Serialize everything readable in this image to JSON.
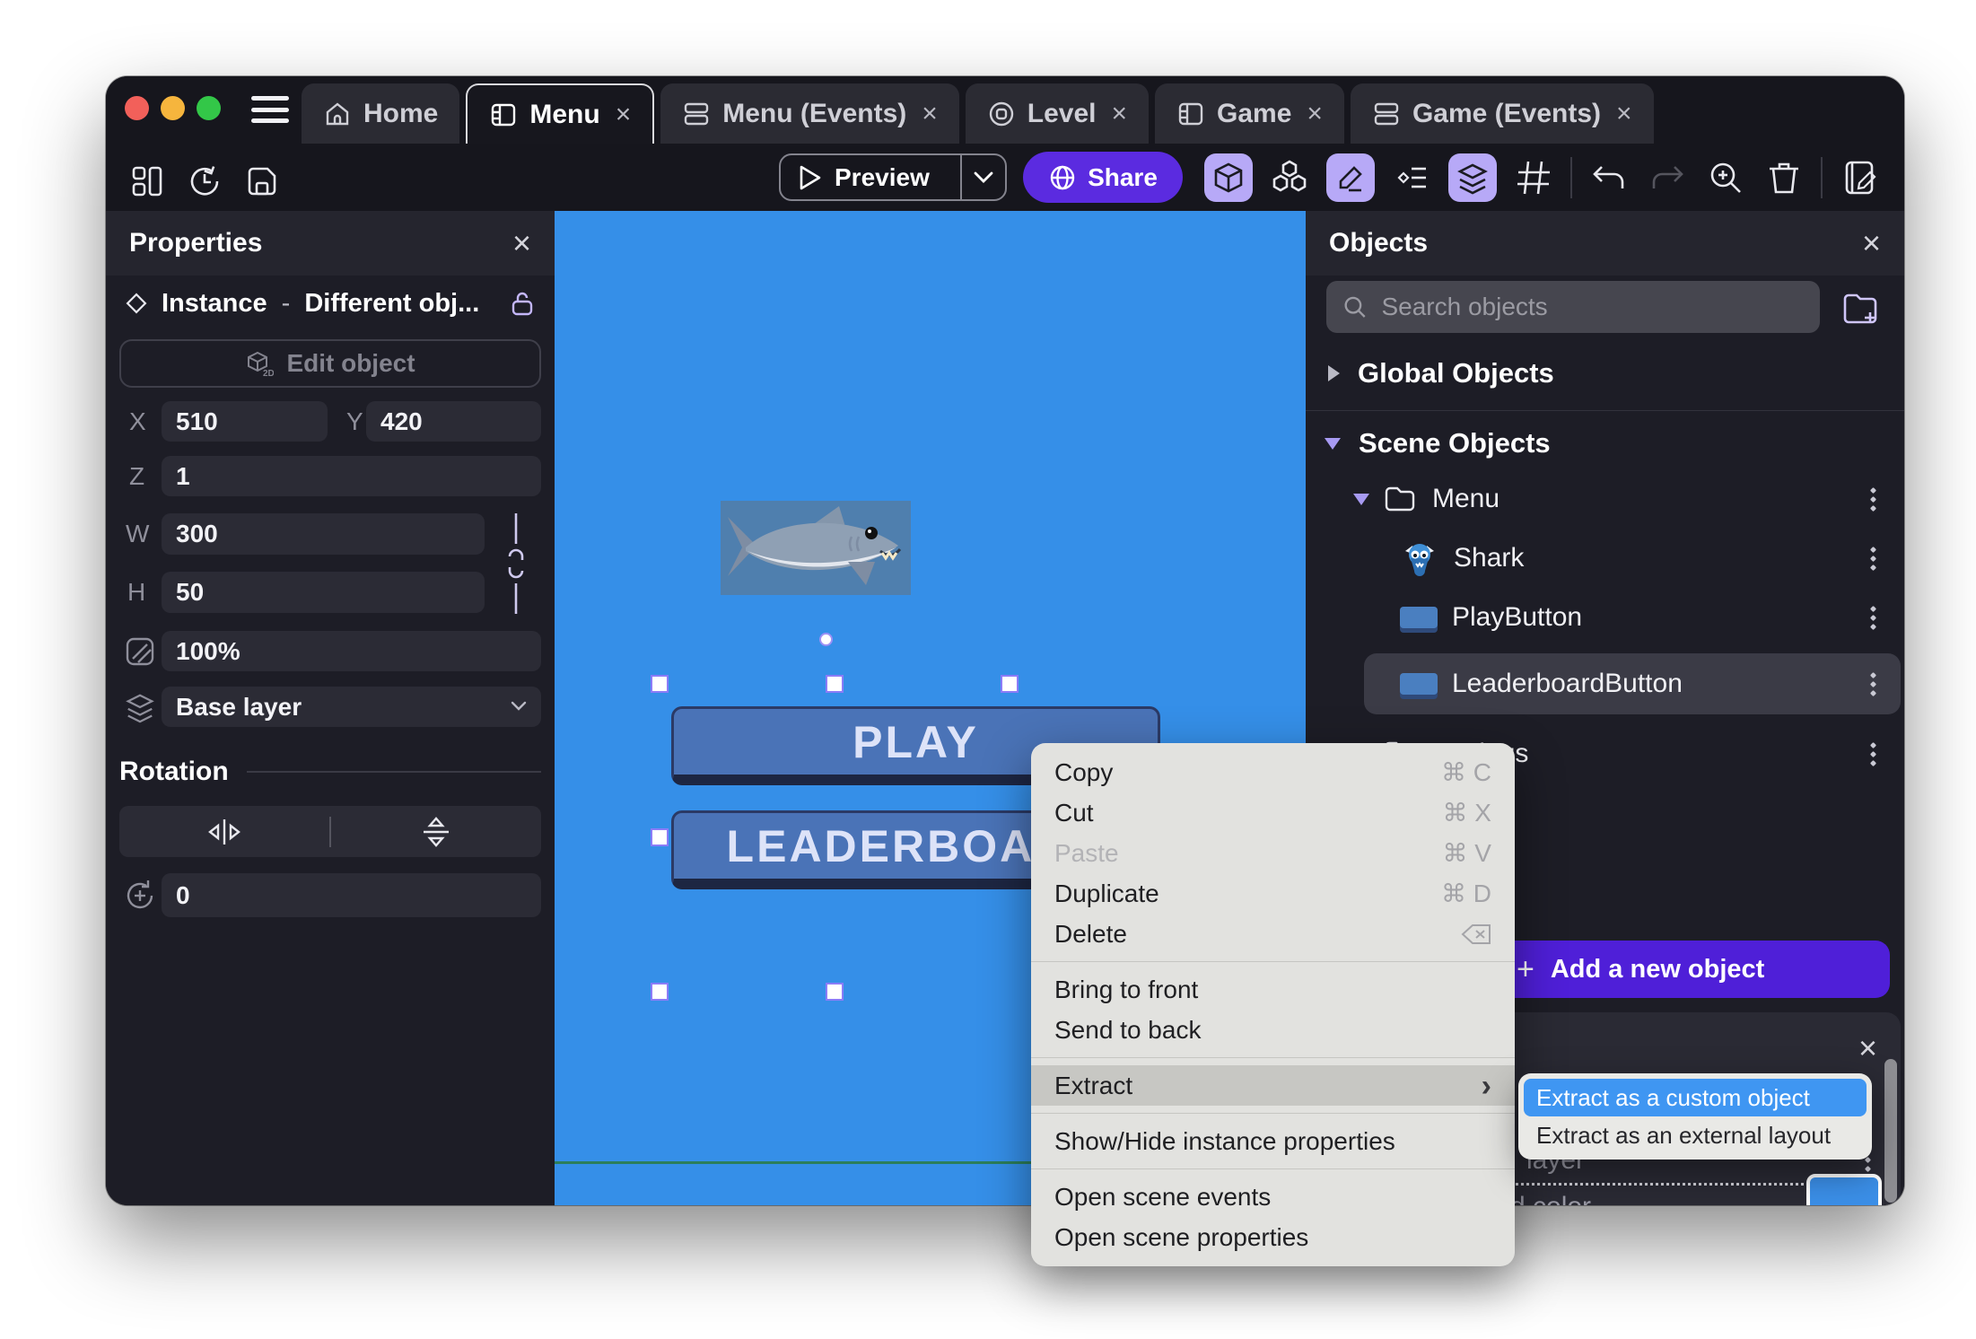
{
  "ui": {
    "close": "×",
    "submenu_arrow": "›",
    "plus": "+"
  },
  "titlebar": {
    "tabs": [
      {
        "label": "Home"
      },
      {
        "label": "Menu"
      },
      {
        "label": "Menu (Events)"
      },
      {
        "label": "Level"
      },
      {
        "label": "Game"
      },
      {
        "label": "Game (Events)"
      }
    ]
  },
  "toolbar": {
    "preview": "Preview",
    "share": "Share"
  },
  "properties": {
    "title": "Properties",
    "instance": "Instance",
    "separator": "-",
    "instance_value": "Different obj...",
    "edit_object": "Edit object",
    "edit_object_badge": "2D",
    "x_label": "X",
    "x_value": "510",
    "y_label": "Y",
    "y_value": "420",
    "z_label": "Z",
    "z_value": "1",
    "w_label": "W",
    "w_value": "300",
    "h_label": "H",
    "h_value": "50",
    "opacity_value": "100%",
    "layer_value": "Base layer",
    "rotation_title": "Rotation",
    "rotation_value": "0"
  },
  "canvas": {
    "play": "PLAY",
    "leaderboard": "LEADERBOARD"
  },
  "objects": {
    "title": "Objects",
    "search_placeholder": "Search objects",
    "global_header": "Global Objects",
    "scene_header": "Scene Objects",
    "folder_menu": "Menu",
    "item_shark": "Shark",
    "item_play": "PlayButton",
    "item_leaderboard": "LeaderboardButton",
    "folder_settings": "Settings",
    "add_button": "Add a new object",
    "layer_fragment": "layer",
    "color_fragment": "d color"
  },
  "context_menu": {
    "items": [
      {
        "label": "Copy",
        "shortcut": "⌘ C"
      },
      {
        "label": "Cut",
        "shortcut": "⌘ X"
      },
      {
        "label": "Paste",
        "shortcut": "⌘ V"
      },
      {
        "label": "Duplicate",
        "shortcut": "⌘ D"
      },
      {
        "label": "Delete"
      },
      {
        "label": "Bring to front"
      },
      {
        "label": "Send to back"
      },
      {
        "label": "Extract"
      },
      {
        "label": "Show/Hide instance properties"
      },
      {
        "label": "Open scene events"
      },
      {
        "label": "Open scene properties"
      }
    ]
  },
  "submenu": {
    "items": [
      {
        "label": "Extract as a custom object"
      },
      {
        "label": "Extract as an external layout"
      }
    ]
  },
  "colors": {
    "canvas_blue": "#358fe8",
    "share_purple": "#5b2be0",
    "add_button_purple": "#4f1fd8",
    "selection_purple": "#8b7cf7",
    "scene_button_blue": "#4a73b7",
    "submenu_highlight_blue": "#3f96f2",
    "green_line": "#2c7e5b"
  }
}
